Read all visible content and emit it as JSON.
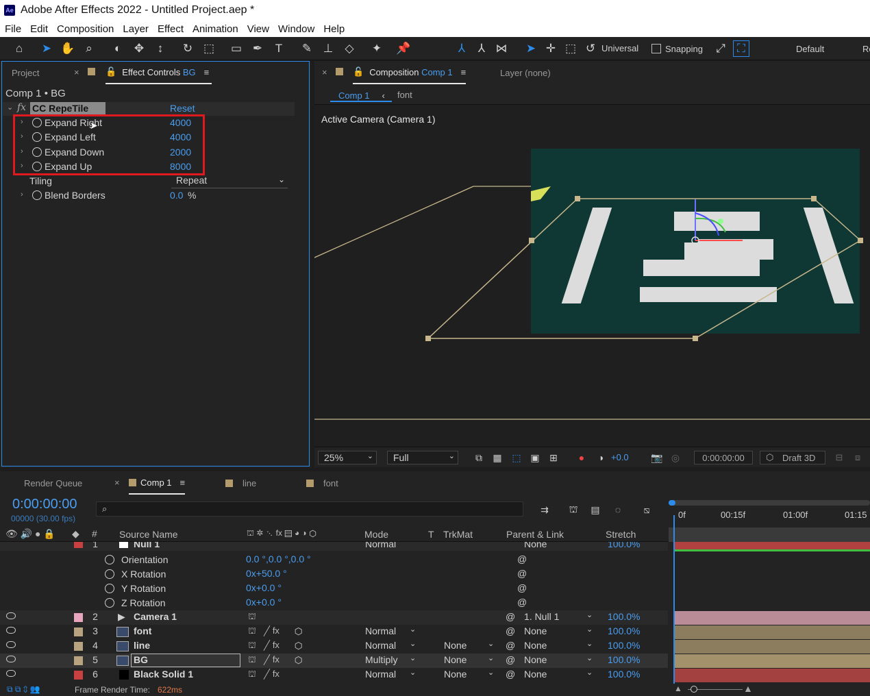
{
  "app": {
    "title": "Adobe After Effects 2022 - Untitled Project.aep *",
    "logo": "Ae"
  },
  "menu": [
    "File",
    "Edit",
    "Composition",
    "Layer",
    "Effect",
    "Animation",
    "View",
    "Window",
    "Help"
  ],
  "toolbar": {
    "universal": "Universal",
    "snapping": "Snapping",
    "workspace": "Default",
    "workspace2": "Re"
  },
  "left_panel": {
    "tab_project": "Project",
    "tab_effect": "Effect Controls",
    "tab_effect_layer": "BG",
    "breadcrumb": "Comp 1 • BG",
    "effect": {
      "fx": "fx",
      "name": "CC RepeTile",
      "reset": "Reset",
      "params": [
        {
          "name": "Expand Right",
          "value": "4000"
        },
        {
          "name": "Expand Left",
          "value": "4000"
        },
        {
          "name": "Expand Down",
          "value": "2000"
        },
        {
          "name": "Expand Up",
          "value": "8000"
        }
      ],
      "tiling_label": "Tiling",
      "tiling_value": "Repeat",
      "blend_label": "Blend Borders",
      "blend_value": "0.0",
      "blend_unit": "%"
    }
  },
  "comp_panel": {
    "tab_comp": "Composition",
    "tab_comp_name": "Comp 1",
    "tab_layer": "Layer (none)",
    "sub_comp": "Comp 1",
    "sub_font": "font",
    "camera_label": "Active Camera (Camera 1)",
    "zoom": "25%",
    "resolution": "Full",
    "exposure": "+0.0",
    "timecode": "0:00:00:00",
    "renderer": "Draft 3D"
  },
  "timeline": {
    "tab_render": "Render Queue",
    "tab_comp": "Comp 1",
    "tab_line": "line",
    "tab_font": "font",
    "timecode": "0:00:00:00",
    "frames": "00000 (30.00 fps)",
    "headers": {
      "source": "Source Name",
      "mode": "Mode",
      "t": "T",
      "trkmat": "TrkMat",
      "parent": "Parent & Link",
      "stretch": "Stretch"
    },
    "ruler": [
      "0f",
      "00:15f",
      "01:00f",
      "01:15"
    ],
    "null_row": {
      "num": "1",
      "name": "Null 1",
      "mode": "Normal",
      "parent": "None",
      "stretch": "100.0%"
    },
    "props": [
      {
        "name": "Orientation",
        "value": "0.0 °,0.0 °,0.0 °"
      },
      {
        "name": "X Rotation",
        "value": "0x+50.0 °"
      },
      {
        "name": "Y Rotation",
        "value": "0x+0.0 °"
      },
      {
        "name": "Z Rotation",
        "value": "0x+0.0 °"
      }
    ],
    "layers": [
      {
        "num": "2",
        "name": "Camera 1",
        "mode": "",
        "trk": "",
        "parent": "1. Null 1",
        "stretch": "100.0%",
        "color": "#e8a6be"
      },
      {
        "num": "3",
        "name": "font",
        "mode": "Normal",
        "trk": "",
        "parent": "None",
        "stretch": "100.0%",
        "color": "#b8a380"
      },
      {
        "num": "4",
        "name": "line",
        "mode": "Normal",
        "trk": "None",
        "parent": "None",
        "stretch": "100.0%",
        "color": "#b8a380"
      },
      {
        "num": "5",
        "name": "BG",
        "mode": "Multiply",
        "trk": "None",
        "parent": "None",
        "stretch": "100.0%",
        "color": "#b8a380"
      },
      {
        "num": "6",
        "name": "Black Solid 1",
        "mode": "Normal",
        "trk": "None",
        "parent": "None",
        "stretch": "100.0%",
        "color": "#c94040"
      }
    ],
    "status": "Frame Render Time:",
    "render_time": "622ms"
  },
  "colors": {
    "accent": "#2d8ceb",
    "highlight_box": "#e0191f",
    "label_null": "#c94040"
  }
}
